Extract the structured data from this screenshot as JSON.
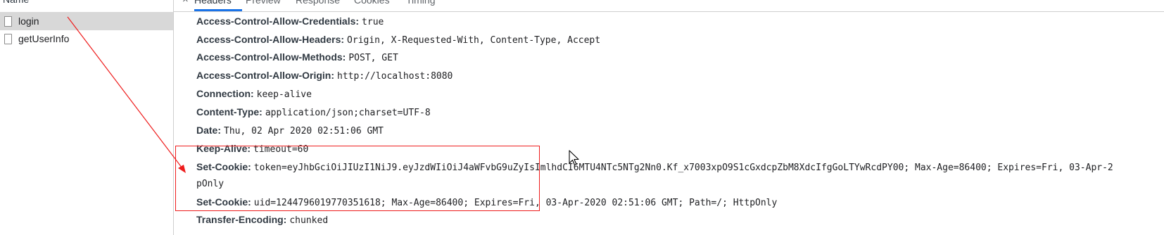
{
  "request_list": {
    "column_header": "Name",
    "items": [
      {
        "label": "login",
        "selected": true
      },
      {
        "label": "getUserInfo",
        "selected": false
      }
    ]
  },
  "tabs": {
    "close_glyph": "×",
    "items": [
      {
        "label": "Headers",
        "active": true
      },
      {
        "label": "Preview",
        "active": false
      },
      {
        "label": "Response",
        "active": false
      },
      {
        "label": "Cookies",
        "active": false
      },
      {
        "label": "Timing",
        "active": false
      }
    ]
  },
  "response_headers": [
    {
      "name": "Access-Control-Allow-Credentials:",
      "value": "true"
    },
    {
      "name": "Access-Control-Allow-Headers:",
      "value": "Origin, X-Requested-With, Content-Type, Accept"
    },
    {
      "name": "Access-Control-Allow-Methods:",
      "value": "POST, GET"
    },
    {
      "name": "Access-Control-Allow-Origin:",
      "value": "http://localhost:8080"
    },
    {
      "name": "Connection:",
      "value": "keep-alive"
    },
    {
      "name": "Content-Type:",
      "value": "application/json;charset=UTF-8"
    },
    {
      "name": "Date:",
      "value": "Thu, 02 Apr 2020 02:51:06 GMT"
    },
    {
      "name": "Keep-Alive:",
      "value": "timeout=60"
    },
    {
      "name": "Set-Cookie:",
      "value": "token=eyJhbGciOiJIUzI1NiJ9.eyJzdWIiOiJ4aWFvbG9uZyIsImlhdCI6MTU4NTc5NTg2Nn0.Kf_x7003xpO9S1cGxdcpZbM8XdcIfgGoLTYwRcdPY00; Max-Age=86400; Expires=Fri, 03-Apr-2",
      "wrap": "pOnly"
    },
    {
      "name": "Set-Cookie:",
      "value": "uid=1244796019770351618; Max-Age=86400; Expires=Fri, 03-Apr-2020 02:51:06 GMT; Path=/; HttpOnly"
    },
    {
      "name": "Transfer-Encoding:",
      "value": "chunked"
    }
  ],
  "colors": {
    "annotation": "#ee1c1c",
    "selected_row": "#d8d8d8",
    "tab_accent": "#1a73e8"
  },
  "icons": [
    "file-icon",
    "close-icon",
    "mouse-cursor-icon",
    "annotation-arrow"
  ]
}
